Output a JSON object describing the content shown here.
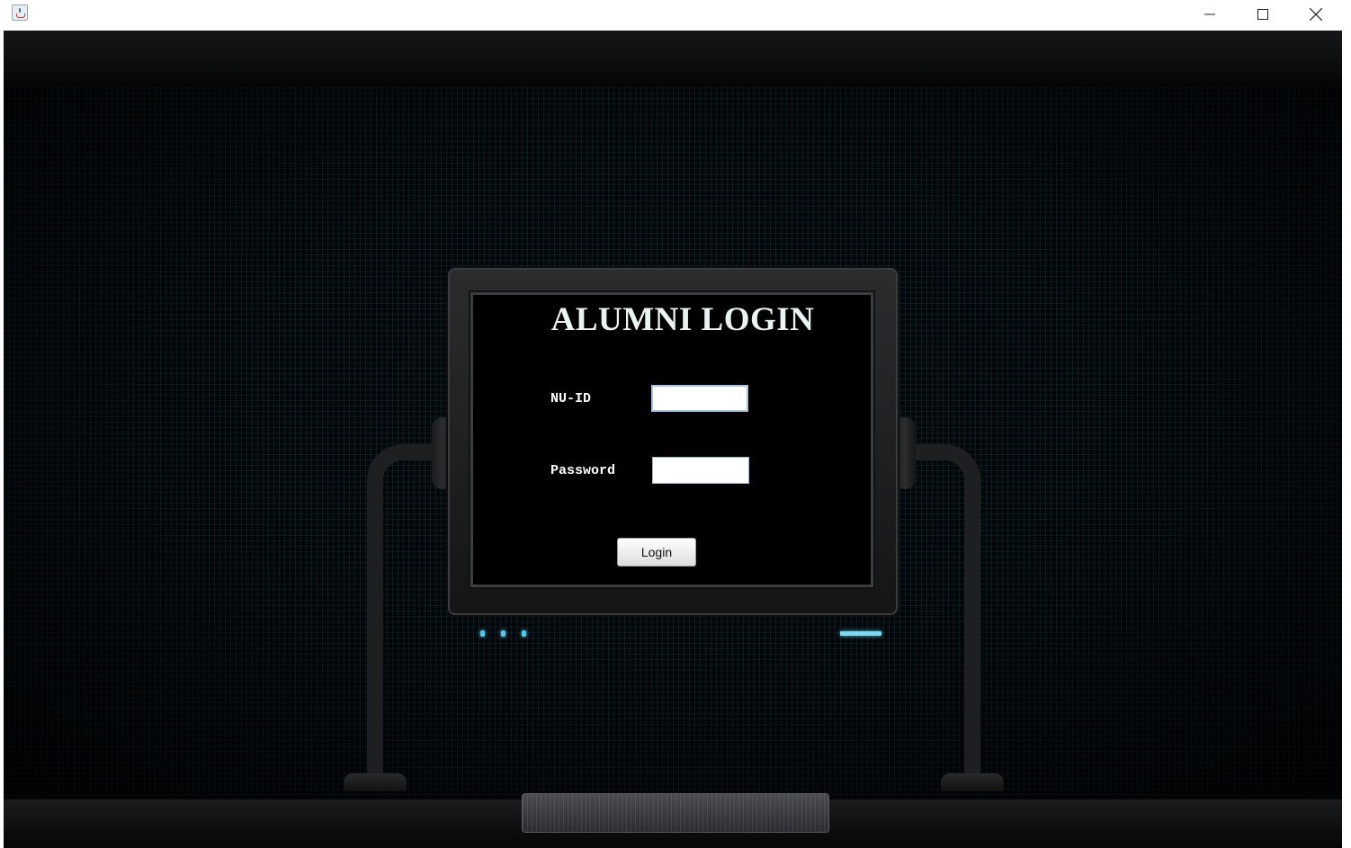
{
  "window": {
    "icon": "java-cup-icon",
    "controls": {
      "minimize": "minimize-icon",
      "maximize": "maximize-icon",
      "close": "close-icon"
    }
  },
  "login": {
    "title": "ALUMNI LOGIN",
    "id_label": "NU-ID",
    "id_value": "",
    "password_label": "Password",
    "password_value": "",
    "submit_label": "Login"
  },
  "colors": {
    "background": "#030405",
    "grid_accent": "#3c8296",
    "title_text": "#eaf3f2",
    "led": "#52c8e6"
  }
}
